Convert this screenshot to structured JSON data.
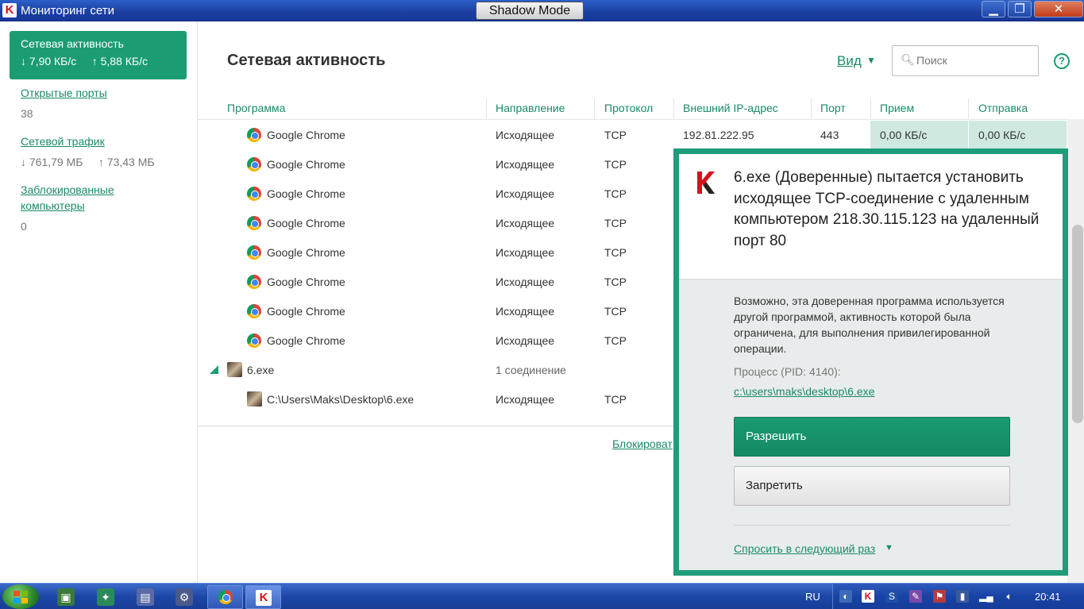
{
  "window": {
    "title": "Мониторинг сети",
    "shadow_mode": "Shadow Mode",
    "buttons": {
      "minimize": "▁",
      "maximize": "❐",
      "close": "✕"
    }
  },
  "sidebar": {
    "active": {
      "label": "Сетевая активность",
      "down": "↓ 7,90 КБ/с",
      "up": "↑ 5,88 КБ/с"
    },
    "items": [
      {
        "label": "Открытые порты",
        "value": "38"
      },
      {
        "label": "Сетевой трафик",
        "down": "↓ 761,79 МБ",
        "up": "↑ 73,43 МБ"
      },
      {
        "label": "Заблокированные компьютеры",
        "line1": "Заблокированные",
        "line2": "компьютеры",
        "value": "0"
      }
    ]
  },
  "main": {
    "title": "Сетевая активность",
    "view_label": "Вид",
    "search_placeholder": "Поиск",
    "help": "?",
    "columns": [
      "Программа",
      "Направление",
      "Протокол",
      "Внешний IP-адрес",
      "Порт",
      "Прием",
      "Отправка"
    ],
    "first_row": {
      "program": "Google Chrome",
      "direction": "Исходящее",
      "protocol": "TCP",
      "ip": "192.81.222.95",
      "port": "443",
      "recv": "0,00 КБ/с",
      "send": "0,00 КБ/с"
    },
    "chrome_rows": [
      {
        "program": "Google Chrome",
        "direction": "Исходящее",
        "protocol": "TCP"
      },
      {
        "program": "Google Chrome",
        "direction": "Исходящее",
        "protocol": "TCP"
      },
      {
        "program": "Google Chrome",
        "direction": "Исходящее",
        "protocol": "TCP"
      },
      {
        "program": "Google Chrome",
        "direction": "Исходящее",
        "protocol": "TCP"
      },
      {
        "program": "Google Chrome",
        "direction": "Исходящее",
        "protocol": "TCP"
      },
      {
        "program": "Google Chrome",
        "direction": "Исходящее",
        "protocol": "TCP"
      },
      {
        "program": "Google Chrome",
        "direction": "Исходящее",
        "protocol": "TCP"
      }
    ],
    "group_row": {
      "program": "6.exe",
      "direction": "1 соединение"
    },
    "child_row": {
      "program": "C:\\Users\\Maks\\Desktop\\6.exe",
      "direction": "Исходящее",
      "protocol": "TCP"
    },
    "block_link": "Блокироват"
  },
  "dialog": {
    "heading": "6.exe (Доверенные) пытается установить исходящее TCP-соединение с удаленным компьютером 218.30.115.123 на удаленный порт 80",
    "description": "Возможно, эта доверенная программа используется другой программой, активность которой была ограничена, для выполнения привилегированной операции.",
    "process_label": "Процесс (PID: 4140):",
    "process_path": "c:\\users\\maks\\desktop\\6.exe",
    "allow_label": "Разрешить",
    "deny_label": "Запретить",
    "ask_label": "Спросить в следующий раз"
  },
  "taskbar": {
    "language": "RU",
    "clock": "20:41"
  },
  "colors": {
    "accent": "#1b9c74",
    "link": "#1a8a6a",
    "highlight": "#cfe9e1",
    "titlebar": "#1b3fa0"
  }
}
